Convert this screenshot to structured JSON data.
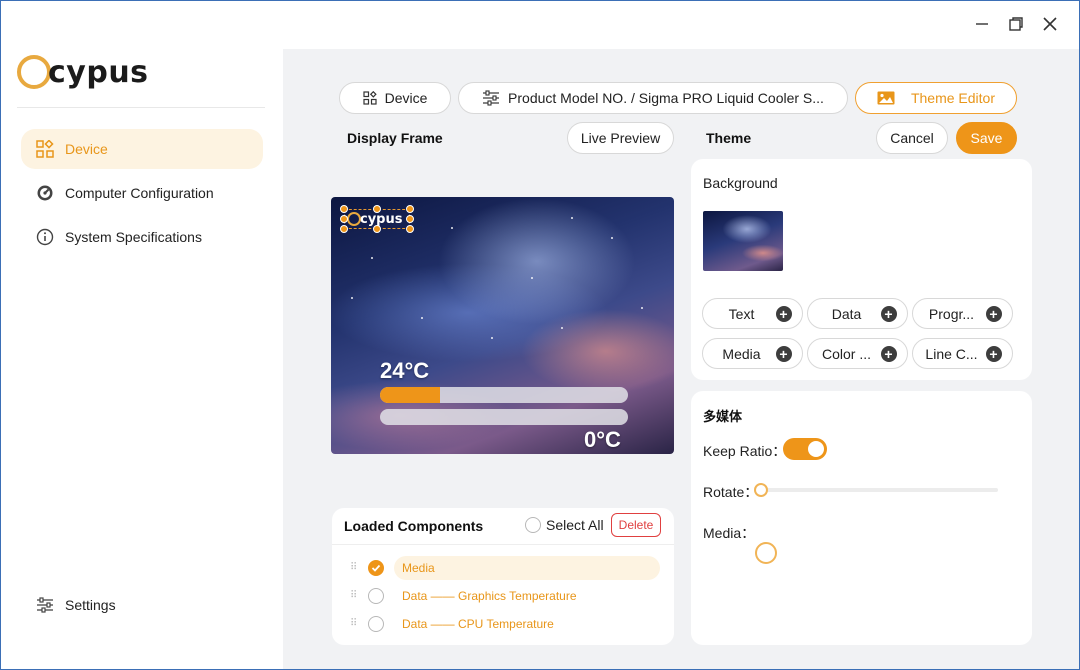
{
  "window": {
    "controls": {
      "minimize": "minimize",
      "restore": "restore",
      "close": "close"
    }
  },
  "brand": {
    "logo_text": "cypus",
    "accent_color": "#ee9519"
  },
  "sidebar": {
    "items": [
      {
        "label": "Device",
        "icon": "grid-icon",
        "active": true
      },
      {
        "label": "Computer Configuration",
        "icon": "gauge-icon",
        "active": false
      },
      {
        "label": "System Specifications",
        "icon": "info-icon",
        "active": false
      }
    ],
    "settings_label": "Settings"
  },
  "breadcrumb": {
    "device": "Device",
    "product": "Product Model NO. / Sigma PRO Liquid Cooler S...",
    "theme_editor": "Theme Editor"
  },
  "display_frame": {
    "title": "Display Frame",
    "live_preview": "Live Preview",
    "overlay_logo_text": "cypus",
    "temp1": "24°C",
    "temp2": "0°C",
    "bar1_fraction": 0.24,
    "bar2_fraction": 0.0
  },
  "theme": {
    "title": "Theme",
    "cancel": "Cancel",
    "save": "Save",
    "background_label": "Background",
    "add_buttons": [
      "Text",
      "Data",
      "Progr...",
      "Media",
      "Color ...",
      "Line C..."
    ]
  },
  "properties": {
    "section_title": "多媒体",
    "keep_ratio_label": "Keep Ratio：",
    "keep_ratio_on": true,
    "rotate_label": "Rotate：",
    "rotate_value": 0,
    "media_label": "Media："
  },
  "loaded_components": {
    "title": "Loaded Components",
    "select_all": "Select All",
    "delete": "Delete",
    "items": [
      {
        "label": "Media",
        "checked": true
      },
      {
        "label": "Data —— Graphics Temperature",
        "checked": false
      },
      {
        "label": "Data —— CPU Temperature",
        "checked": false
      }
    ]
  }
}
